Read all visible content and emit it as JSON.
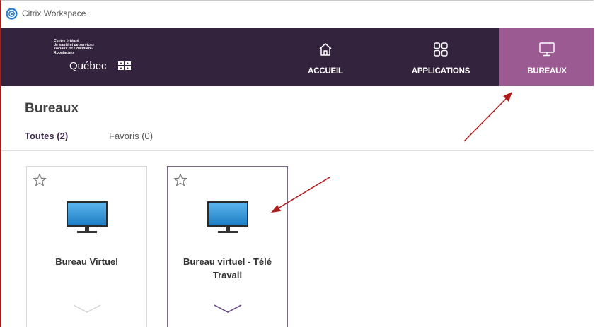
{
  "window": {
    "title": "Citrix Workspace"
  },
  "logo": {
    "lines": [
      "Centre intégré",
      "de santé et de services",
      "sociaux de Chaudière-",
      "Appalaches"
    ],
    "wordmark": "Québec"
  },
  "nav": {
    "items": [
      {
        "label": "ACCUEIL",
        "icon": "home-icon"
      },
      {
        "label": "APPLICATIONS",
        "icon": "apps-grid-icon"
      },
      {
        "label": "BUREAUX",
        "icon": "desktop-icon",
        "active": true
      }
    ],
    "active_color": "#9b5a92",
    "header_color": "#34233d"
  },
  "page": {
    "title": "Bureaux",
    "tabs": [
      {
        "label": "Toutes (2)",
        "active": true
      },
      {
        "label": "Favoris (0)",
        "active": false
      }
    ]
  },
  "cards": [
    {
      "label": "Bureau Virtuel",
      "favorite": false,
      "icon": "monitor-icon",
      "selected": false
    },
    {
      "label": "Bureau virtuel - Télé Travail",
      "favorite": false,
      "icon": "monitor-icon",
      "selected": true
    }
  ],
  "annotations": {
    "arrow_color": "#b01c1c"
  }
}
